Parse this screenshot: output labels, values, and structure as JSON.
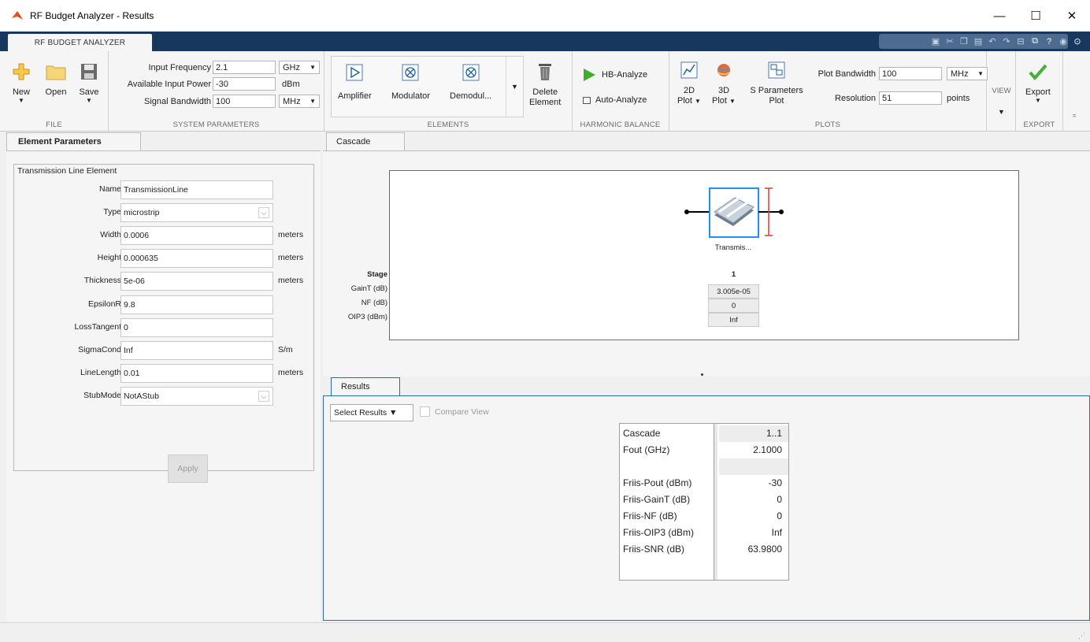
{
  "window": {
    "title": "RF Budget Analyzer - Results",
    "controls": {
      "minimize": "—",
      "maximize": "☐",
      "close": "✕"
    }
  },
  "ribbon_tab": {
    "label": "RF BUDGET ANALYZER"
  },
  "file_group": {
    "label": "FILE",
    "new_label": "New",
    "open_label": "Open",
    "save_label": "Save"
  },
  "system_params": {
    "label": "SYSTEM PARAMETERS",
    "input_frequency": {
      "label": "Input Frequency",
      "value": "2.1",
      "unit": "GHz"
    },
    "available_input_power": {
      "label": "Available Input Power",
      "value": "-30",
      "unit": "dBm"
    },
    "signal_bandwidth": {
      "label": "Signal Bandwidth",
      "value": "100",
      "unit": "MHz"
    }
  },
  "elements_group": {
    "label": "ELEMENTS",
    "amplifier": "Amplifier",
    "modulator": "Modulator",
    "demodulator": "Demodul...",
    "delete_line1": "Delete",
    "delete_line2": "Element"
  },
  "harmonic_balance": {
    "label": "HARMONIC BALANCE",
    "hb_analyze": "HB-Analyze",
    "auto_analyze": "Auto-Analyze"
  },
  "plots_group": {
    "label": "PLOTS",
    "plot2d_line1": "2D",
    "plot2d_line2": "Plot",
    "plot3d_line1": "3D",
    "plot3d_line2": "Plot",
    "sparam_line1": "S Parameters",
    "sparam_line2": "Plot",
    "plot_bandwidth": {
      "label": "Plot Bandwidth",
      "value": "100",
      "unit": "MHz"
    },
    "resolution": {
      "label": "Resolution",
      "value": "51",
      "unit": "points"
    }
  },
  "view_group": {
    "label": "VIEW"
  },
  "export_group": {
    "label": "EXPORT",
    "export_label": "Export"
  },
  "element_params": {
    "tab": "Element Parameters",
    "legend": "Transmission Line Element",
    "rows": [
      {
        "label": "Name",
        "value": "TransmissionLine",
        "unit": ""
      },
      {
        "label": "Type",
        "value": "microstrip",
        "unit": ""
      },
      {
        "label": "Width",
        "value": "0.0006",
        "unit": "meters"
      },
      {
        "label": "Height",
        "value": "0.000635",
        "unit": "meters"
      },
      {
        "label": "Thickness",
        "value": "5e-06",
        "unit": "meters"
      },
      {
        "label": "EpsilonR",
        "value": "9.8",
        "unit": ""
      },
      {
        "label": "LossTangent",
        "value": "0",
        "unit": ""
      },
      {
        "label": "SigmaCond",
        "value": "Inf",
        "unit": "S/m"
      },
      {
        "label": "LineLength",
        "value": "0.01",
        "unit": "meters"
      },
      {
        "label": "StubMode",
        "value": "NotAStub",
        "unit": ""
      }
    ],
    "apply": "Apply"
  },
  "cascade": {
    "tab": "Cascade",
    "element_label": "Transmis...",
    "stage_header": "Stage",
    "stage_number": "1",
    "rows": [
      {
        "label": "GainT (dB)",
        "value": "3.005e-05"
      },
      {
        "label": "NF (dB)",
        "value": "0"
      },
      {
        "label": "OIP3 (dBm)",
        "value": "Inf"
      }
    ]
  },
  "results": {
    "tab": "Results",
    "select_results": "Select Results ▼",
    "compare_view": "Compare View",
    "table": [
      {
        "key": "Cascade",
        "value": "1..1"
      },
      {
        "key": "Fout (GHz)",
        "value": "2.1000"
      },
      {
        "key": "",
        "value": ""
      },
      {
        "key": "Friis-Pout (dBm)",
        "value": "-30"
      },
      {
        "key": "Friis-GainT (dB)",
        "value": "0"
      },
      {
        "key": "Friis-NF (dB)",
        "value": "0"
      },
      {
        "key": "Friis-OIP3 (dBm)",
        "value": "Inf"
      },
      {
        "key": "Friis-SNR (dB)",
        "value": "63.9800"
      }
    ]
  },
  "colors": {
    "ribbon_dark": "#17375e",
    "accent_blue": "#1e90ff",
    "results_border": "#2f6aa7"
  }
}
